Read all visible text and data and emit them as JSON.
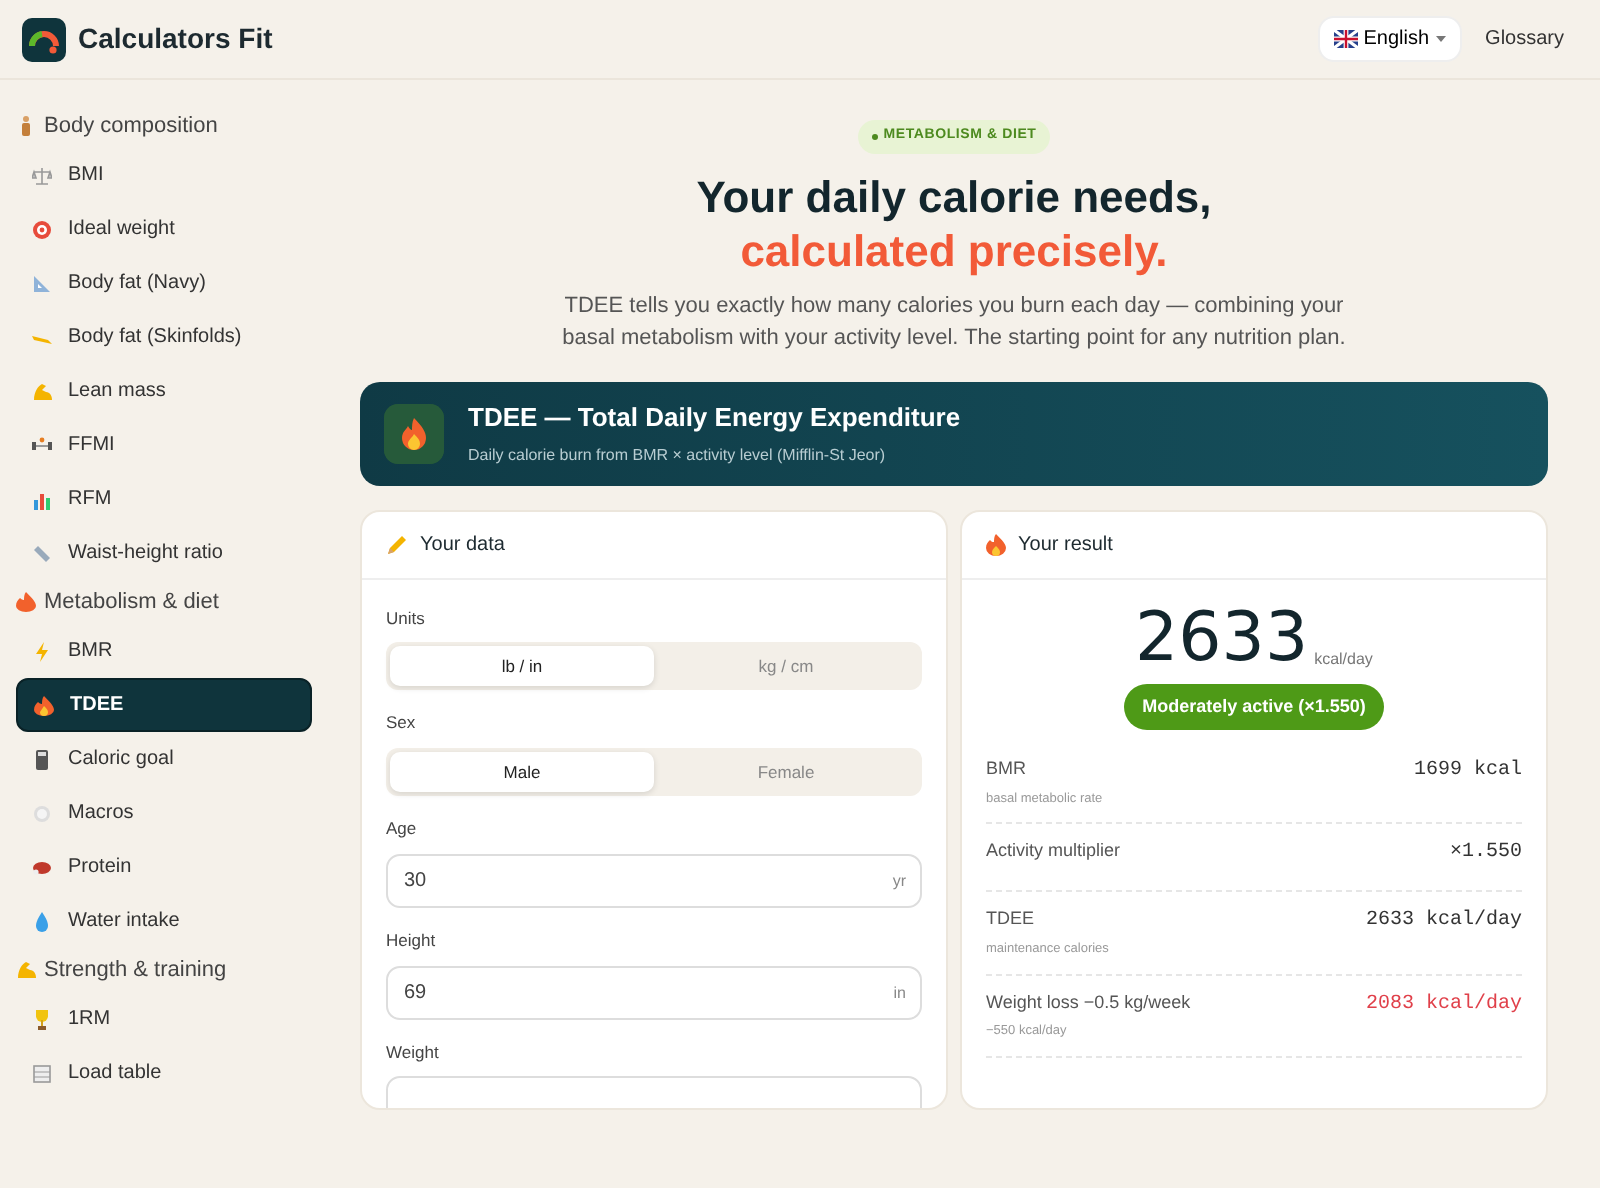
{
  "brand": {
    "name": "Calculators Fit"
  },
  "header": {
    "language": "English",
    "links": [
      "Glossary"
    ]
  },
  "sidebar": {
    "sections": [
      {
        "title": "Body composition",
        "items": [
          {
            "label": "BMI",
            "selected": false
          },
          {
            "label": "Ideal weight",
            "selected": false
          },
          {
            "label": "Body fat (Navy)",
            "selected": false
          },
          {
            "label": "Body fat (Skinfolds)",
            "selected": false
          },
          {
            "label": "Lean mass",
            "selected": false
          },
          {
            "label": "FFMI",
            "selected": false
          },
          {
            "label": "RFM",
            "selected": false
          },
          {
            "label": "Waist-height ratio",
            "selected": false
          }
        ]
      },
      {
        "title": "Metabolism & diet",
        "items": [
          {
            "label": "BMR",
            "selected": false
          },
          {
            "label": "TDEE",
            "selected": true
          },
          {
            "label": "Caloric goal",
            "selected": false
          },
          {
            "label": "Macros",
            "selected": false
          },
          {
            "label": "Protein",
            "selected": false
          },
          {
            "label": "Water intake",
            "selected": false
          }
        ]
      },
      {
        "title": "Strength & training",
        "items": [
          {
            "label": "1RM",
            "selected": false
          },
          {
            "label": "Load table",
            "selected": false
          }
        ]
      }
    ]
  },
  "hero": {
    "tag": "METABOLISM & DIET",
    "title_line1": "Your daily calorie needs,",
    "title_line2": "calculated precisely.",
    "lead": "TDEE tells you exactly how many calories you burn each day — combining your basal metabolism with your activity level. The starting point for any nutrition plan."
  },
  "banner": {
    "title": "TDEE — Total Daily Energy Expenditure",
    "subtitle": "Daily calorie burn from BMR × activity level (Mifflin-St Jeor)"
  },
  "data_card": {
    "title": "Your data",
    "fields": [
      {
        "kind": "toggle",
        "label": "Units",
        "options": [
          {
            "label": "lb / in",
            "selected": true
          },
          {
            "label": "kg / cm",
            "selected": false
          }
        ]
      },
      {
        "kind": "toggle",
        "label": "Sex",
        "options": [
          {
            "label": "Male",
            "selected": true
          },
          {
            "label": "Female",
            "selected": false
          }
        ]
      },
      {
        "kind": "input",
        "label": "Age",
        "value": "30",
        "unit": "yr"
      },
      {
        "kind": "input",
        "label": "Height",
        "value": "69",
        "unit": "in"
      },
      {
        "kind": "input",
        "label": "Weight"
      }
    ]
  },
  "result_card": {
    "title": "Your result",
    "value": "2633",
    "unit": "kcal/day",
    "activity": "Moderately active (×1.550)",
    "rows": [
      {
        "label": "BMR",
        "note": "basal metabolic rate",
        "value": "1699 kcal",
        "highlight": false
      },
      {
        "label": "Activity multiplier",
        "value": "×1.550",
        "highlight": false
      },
      {
        "label": "TDEE",
        "note": "maintenance calories",
        "value": "2633 kcal/day",
        "highlight": false
      },
      {
        "label": "Weight loss −0.5 kg/week",
        "note": "−550 kcal/day",
        "value": "2083 kcal/day",
        "highlight": true
      }
    ]
  }
}
